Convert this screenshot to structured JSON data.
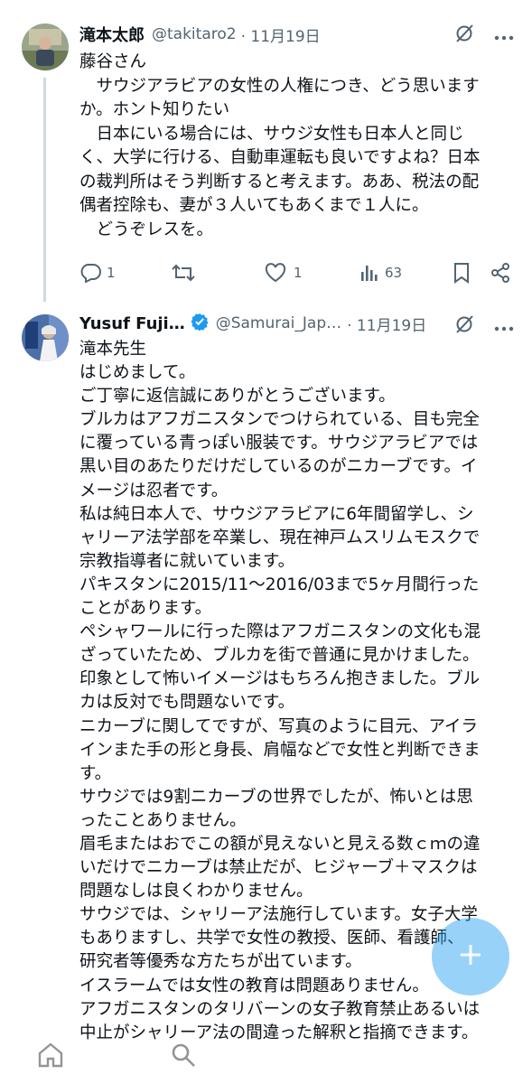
{
  "colors": {
    "accent": "#1d9bf0",
    "text": "#0f1419",
    "muted": "#536471",
    "divider": "#eff3f4"
  },
  "tweet1": {
    "name": "滝本太郎",
    "handle": "@takitaro2",
    "date": "· 11月19日",
    "text": "藤谷さん\n　サウジアラビアの女性の人権につき、どう思います\nか。ホント知りたい\n　日本にいる場合には、サウジ女性も日本人と同じ\nく、大学に行ける、自動車運転も良いですよね？日本\nの裁判所はそう判断すると考えます。ああ、税法の配\n偶者控除も、妻が３人いてもあくまで１人に。\n　どうぞレスを。",
    "replies": "1",
    "likes": "1",
    "views": "63",
    "icons": [
      "grok-icon",
      "more-icon",
      "reply-icon",
      "retweet-icon",
      "like-icon",
      "views-icon",
      "bookmark-icon",
      "share-icon"
    ]
  },
  "tweet2": {
    "name": "Yusuf Fuji…",
    "handle": "@Samurai_Jap…",
    "date": "· 11月19日",
    "text": "滝本先生\nはじめまして。\nご丁寧に返信誠にありがとうございます。\nブルカはアフガニスタンでつけられている、目も完全\nに覆っている青っぽい服装です。サウジアラビアでは\n黒い目のあたりだけだしているのがニカーブです。イ\nメージは忍者です。\n私は純日本人で、サウジアラビアに6年間留学し、シ\nャリーア法学部を卒業し、現在神戸ムスリムモスクで\n宗教指導者に就いています。\nパキスタンに2015/11〜2016/03まで5ヶ月間行った\nことがあります。\nペシャワールに行った際はアフガニスタンの文化も混\nざっていたため、ブルカを街で普通に見かけました。\n印象として怖いイメージはもちろん抱きました。ブル\nカは反対でも問題ないです。\nニカーブに関してですが、写真のように目元、アイラ\nインまた手の形と身長、肩幅などで女性と判断できま\nす。\nサウジでは9割ニカーブの世界でしたが、怖いとは思\nったことありません。\n眉毛またはおでこの額が見えないと見える数ｃｍの違\nいだけでニカーブは禁止だが、ヒジャーブ＋マスクは\n問題なしは良くわかりません。\nサウジでは、シャリーア法施行しています。女子大学\nもありますし、共学で女性の教授、医師、看護師、\n研究者等優秀な方たちが出ています。\nイスラームでは女性の教育は問題ありません。\nアフガニスタンのタリバーンの女子教育禁止あるいは\n中止がシャリーア法の間違った解釈と指摘できます。",
    "icons": [
      "verified-badge-icon",
      "grok-icon",
      "more-icon"
    ]
  },
  "fab": {
    "icon": "compose-plus-icon"
  },
  "bottom_nav": {
    "icons": [
      "home-icon",
      "search-icon"
    ]
  }
}
